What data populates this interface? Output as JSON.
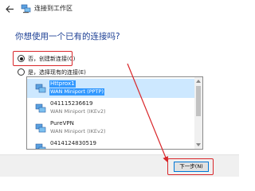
{
  "window": {
    "title": "连接到工作区"
  },
  "heading": "你想使用一个已有的连接吗?",
  "options": [
    {
      "label": "否，创建新连接(C)",
      "selected": true
    },
    {
      "label": "是，选择现有的连接(E)",
      "selected": false
    }
  ],
  "connections": [
    {
      "name": "Httprox1",
      "type": "WAN Miniport (PPTP)",
      "selected": true,
      "icon": "network-icon"
    },
    {
      "name": "041115236619",
      "type": "WAN Miniport (IKEv2)",
      "selected": false,
      "icon": "network-icon"
    },
    {
      "name": "PureVPN",
      "type": "WAN Miniport (IKEv2)",
      "selected": false,
      "icon": "network-icon"
    },
    {
      "name": "0414124830519",
      "type": "",
      "selected": false,
      "icon": "network-icon"
    }
  ],
  "footer": {
    "next_label": "下一步(N)"
  },
  "colors": {
    "accent": "#1c3f94",
    "highlight": "#d9262a",
    "selection": "#3399ff"
  }
}
